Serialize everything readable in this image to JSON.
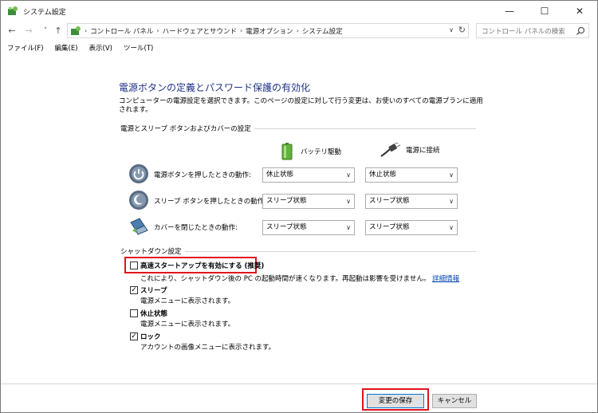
{
  "window": {
    "title": "システム設定"
  },
  "nav": {
    "back": "←",
    "forward": "→",
    "recent": "˅",
    "up": "↑"
  },
  "address": {
    "breadcrumbs": [
      "コントロール パネル",
      "ハードウェアとサウンド",
      "電源オプション",
      "システム設定"
    ],
    "refresh": "↻"
  },
  "search": {
    "placeholder": "コントロール パネルの検索"
  },
  "menu": [
    "ファイル(F)",
    "編集(E)",
    "表示(V)",
    "ツール(T)"
  ],
  "page": {
    "heading": "電源ボタンの定義とパスワード保護の有効化",
    "description": "コンピューターの電源設定を選択できます。このページの設定に対して行う変更は、お使いのすべての電源プランに適用されます。"
  },
  "power_section": {
    "label": "電源とスリープ ボタンおよびカバーの設定",
    "col_battery": "バッテリ駆動",
    "col_ac": "電源に接続",
    "rows": [
      {
        "label": "電源ボタンを押したときの動作:",
        "battery": "休止状態",
        "ac": "休止状態",
        "icon": "power-button-icon"
      },
      {
        "label": "スリープ ボタンを押したときの動作:",
        "battery": "スリープ状態",
        "ac": "スリープ状態",
        "icon": "sleep-button-icon"
      },
      {
        "label": "カバーを閉じたときの動作:",
        "battery": "スリープ状態",
        "ac": "スリープ状態",
        "icon": "laptop-lid-icon"
      }
    ]
  },
  "shutdown_section": {
    "label": "シャットダウン設定",
    "fast_startup": {
      "label": "高速スタートアップを有効にする (推奨)",
      "checked": false,
      "desc": "これにより、シャットダウン後の PC の起動時間が速くなります。再起動は影響を受けません。",
      "link": "詳細情報"
    },
    "sleep": {
      "label": "スリープ",
      "checked": true,
      "desc": "電源メニューに表示されます。"
    },
    "hibernate": {
      "label": "休止状態",
      "checked": false,
      "desc": "電源メニューに表示されます。"
    },
    "lock": {
      "label": "ロック",
      "checked": true,
      "desc": "アカウントの画像メニューに表示されます。"
    }
  },
  "footer": {
    "save": "変更の保存",
    "cancel": "キャンセル"
  },
  "colors": {
    "heading": "#1e3287",
    "highlight": "#e0141e",
    "link": "#0645ad"
  }
}
